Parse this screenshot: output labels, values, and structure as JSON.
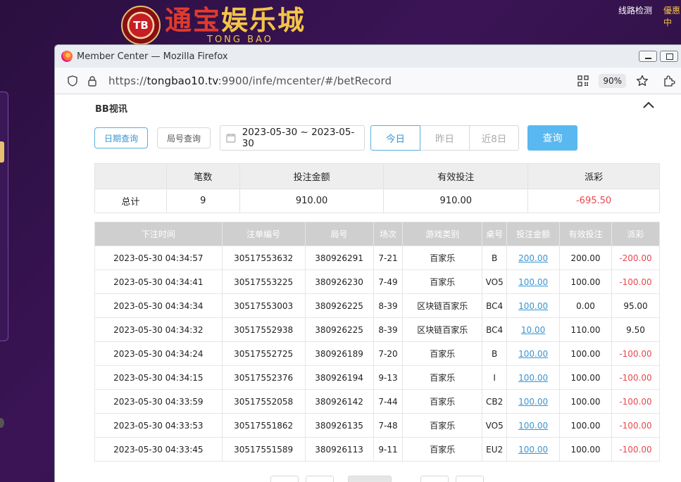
{
  "site": {
    "logo_badge": "TB",
    "logo_cn_part1": "通宝",
    "logo_cn_part2": "娱乐城",
    "logo_en": "TONG BAO",
    "top_links": [
      "线路检测",
      "優惠中"
    ]
  },
  "browser": {
    "title": "Member Center — Mozilla Firefox",
    "url_prefix": "https://",
    "url_domain": "tongbao10.tv",
    "url_rest": ":9900/infe/mcenter/#/betRecord",
    "zoom": "90%"
  },
  "panel": {
    "section_title": "BB视讯",
    "tab_date": "日期查询",
    "tab_round": "局号查询",
    "date_range": "2023-05-30 ~ 2023-05-30",
    "quick_ranges": [
      "今日",
      "昨日",
      "近8日"
    ],
    "query_button": "查询"
  },
  "summary": {
    "headers": [
      "",
      "笔数",
      "投注金额",
      "有效投注",
      "派彩"
    ],
    "row": [
      "总计",
      "9",
      "910.00",
      "910.00",
      "-695.50"
    ]
  },
  "records": {
    "headers": [
      "下注时间",
      "注单编号",
      "局号",
      "场次",
      "游戏类别",
      "桌号",
      "投注金额",
      "有效投注",
      "派彩"
    ],
    "rows": [
      [
        "2023-05-30 04:34:57",
        "30517553632",
        "380926291",
        "7-21",
        "百家乐",
        "B",
        "200.00",
        "200.00",
        "-200.00"
      ],
      [
        "2023-05-30 04:34:41",
        "30517553225",
        "380926230",
        "7-49",
        "百家乐",
        "VO5",
        "100.00",
        "100.00",
        "-100.00"
      ],
      [
        "2023-05-30 04:34:34",
        "30517553003",
        "380926225",
        "8-39",
        "区块链百家乐",
        "BC4",
        "100.00",
        "0.00",
        "95.00"
      ],
      [
        "2023-05-30 04:34:32",
        "30517552938",
        "380926225",
        "8-39",
        "区块链百家乐",
        "BC4",
        "10.00",
        "110.00",
        "9.50"
      ],
      [
        "2023-05-30 04:34:24",
        "30517552725",
        "380926189",
        "7-20",
        "百家乐",
        "B",
        "100.00",
        "100.00",
        "-100.00"
      ],
      [
        "2023-05-30 04:34:15",
        "30517552376",
        "380926194",
        "9-13",
        "百家乐",
        "I",
        "100.00",
        "100.00",
        "-100.00"
      ],
      [
        "2023-05-30 04:33:59",
        "30517552058",
        "380926142",
        "7-44",
        "百家乐",
        "CB2",
        "100.00",
        "100.00",
        "-100.00"
      ],
      [
        "2023-05-30 04:33:53",
        "30517551862",
        "380926135",
        "7-48",
        "百家乐",
        "VO5",
        "100.00",
        "100.00",
        "-100.00"
      ],
      [
        "2023-05-30 04:33:45",
        "30517551589",
        "380926113",
        "9-11",
        "百家乐",
        "EU2",
        "100.00",
        "100.00",
        "-100.00"
      ]
    ]
  },
  "colors": {
    "accent": "#5ab8f0",
    "link": "#3a94cf",
    "negative": "#e8474d"
  }
}
